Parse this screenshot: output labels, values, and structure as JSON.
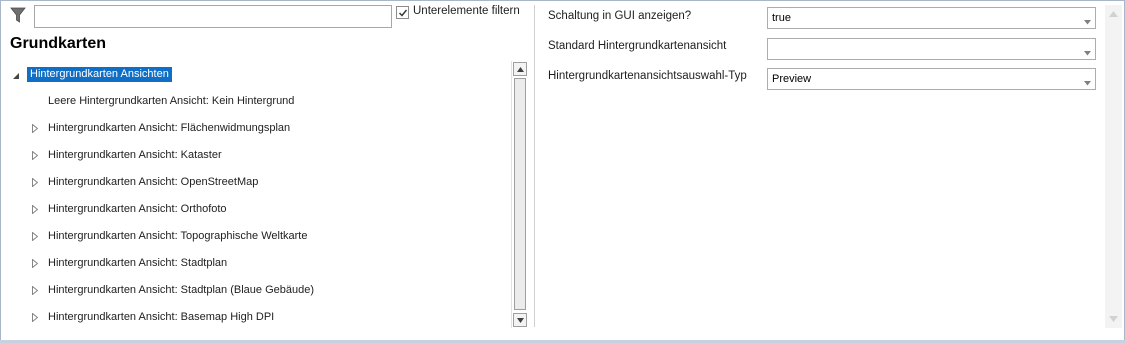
{
  "filter": {
    "placeholder": "",
    "value": "",
    "checkbox_checked": true,
    "checkbox_label": "Unterelemente filtern"
  },
  "title": "Grundkarten",
  "tree": {
    "root": {
      "label": "Hintergrundkarten Ansichten",
      "expanded": true,
      "selected": true
    },
    "items": [
      {
        "label": "Leere Hintergrundkarten Ansicht: Kein Hintergrund",
        "expandable": false
      },
      {
        "label": "Hintergrundkarten Ansicht: Flächenwidmungsplan",
        "expandable": true
      },
      {
        "label": "Hintergrundkarten Ansicht: Kataster",
        "expandable": true
      },
      {
        "label": "Hintergrundkarten Ansicht: OpenStreetMap",
        "expandable": true
      },
      {
        "label": "Hintergrundkarten Ansicht: Orthofoto",
        "expandable": true
      },
      {
        "label": "Hintergrundkarten Ansicht: Topographische Weltkarte",
        "expandable": true
      },
      {
        "label": "Hintergrundkarten Ansicht: Stadtplan",
        "expandable": true
      },
      {
        "label": "Hintergrundkarten Ansicht: Stadtplan (Blaue Gebäude)",
        "expandable": true
      },
      {
        "label": "Hintergrundkarten Ansicht: Basemap High DPI",
        "expandable": true
      }
    ]
  },
  "properties": [
    {
      "label": "Schaltung in GUI anzeigen?",
      "value": "true"
    },
    {
      "label": "Standard Hintergrundkartenansicht",
      "value": ""
    },
    {
      "label": "Hintergrundkartenansichtsauswahl-Typ",
      "value": "Preview"
    }
  ],
  "colors": {
    "selection": "#0f6fc6",
    "border": "#a9b6c8"
  },
  "icons": {
    "filter": "filter-funnel-icon",
    "expand": "triangle-right-icon",
    "collapse": "triangle-down-icon",
    "dropdown": "chevron-down-icon"
  }
}
